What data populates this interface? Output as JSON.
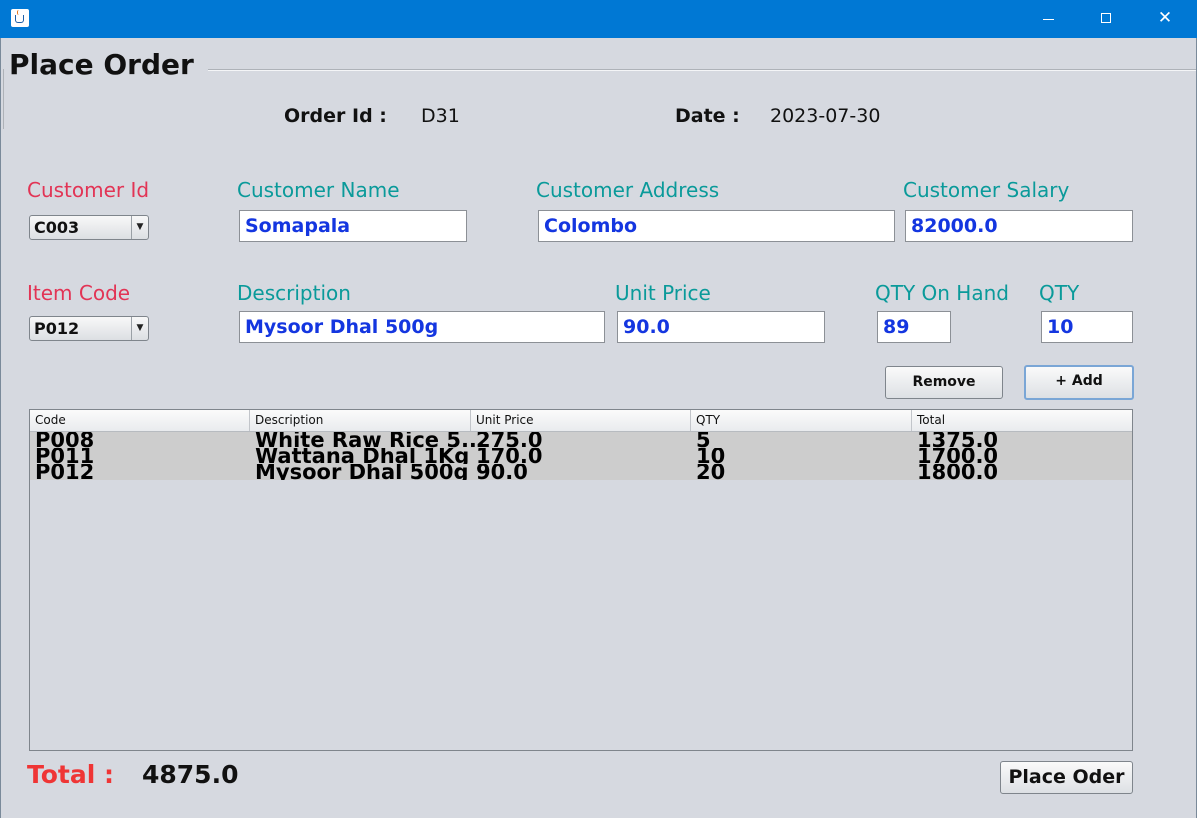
{
  "window": {
    "minimize_glyph": "",
    "close_glyph": "✕"
  },
  "heading": "Place Order",
  "order": {
    "id_label": "Order Id :",
    "id_value": "D31",
    "date_label": "Date :",
    "date_value": "2023-07-30"
  },
  "customer": {
    "id_label": "Customer Id",
    "id_value": "C003",
    "name_label": "Customer Name",
    "name_value": "Somapala",
    "address_label": "Customer Address",
    "address_value": "Colombo",
    "salary_label": "Customer Salary",
    "salary_value": "82000.0"
  },
  "item": {
    "code_label": "Item Code",
    "code_value": "P012",
    "desc_label": "Description",
    "desc_value": "Mysoor Dhal 500g",
    "price_label": "Unit Price",
    "price_value": "90.0",
    "onhand_label": "QTY On Hand",
    "onhand_value": "89",
    "qty_label": "QTY",
    "qty_value": "10"
  },
  "buttons": {
    "remove": "Remove",
    "add": "+ Add",
    "place_order": "Place Oder"
  },
  "table": {
    "headers": [
      "Code",
      "Description",
      "Unit Price",
      "QTY",
      "Total"
    ],
    "rows": [
      [
        "P008",
        "White Raw Rice 5...",
        "275.0",
        "5",
        "1375.0"
      ],
      [
        "P011",
        "Wattana Dhal 1Kg",
        "170.0",
        "10",
        "1700.0"
      ],
      [
        "P012",
        "Mysoor Dhal 500g",
        "90.0",
        "20",
        "1800.0"
      ]
    ]
  },
  "total": {
    "label": "Total :",
    "value": "4875.0"
  },
  "colors": {
    "titlebar": "#0078d4",
    "label_teal": "#0a9a9a",
    "label_red": "#e23455",
    "value_blue": "#1436e0",
    "total_red": "#ef3535"
  },
  "icons": [
    "java-app-icon",
    "minimize-icon",
    "maximize-icon",
    "close-icon",
    "dropdown-arrow-icon"
  ]
}
